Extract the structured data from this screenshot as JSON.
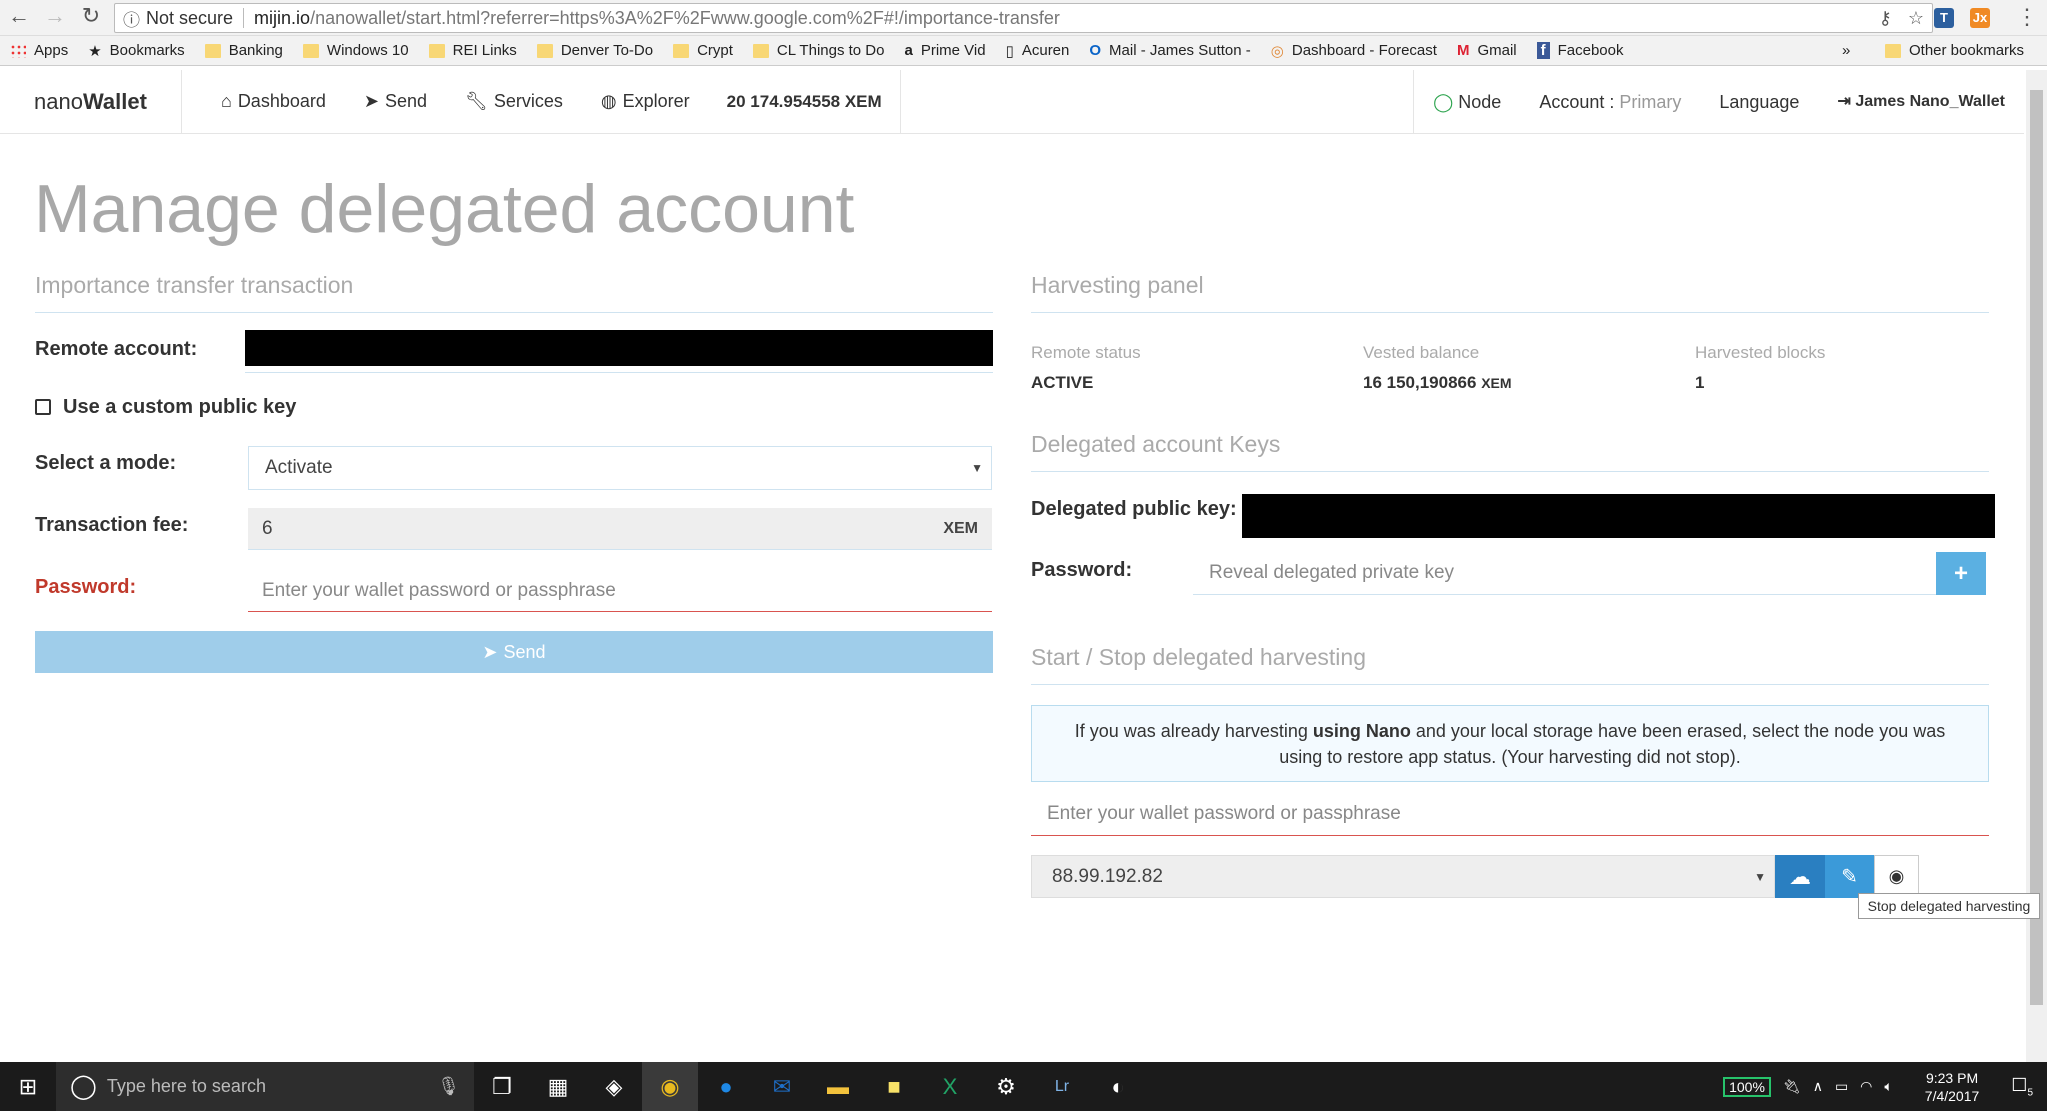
{
  "browser": {
    "security": "Not secure",
    "url_host": "mijin.io",
    "url_path": "/nanowallet/start.html?referrer=https%3A%2F%2Fwww.google.com%2F#!/importance-transfer",
    "bookmarks": [
      "Apps",
      "Bookmarks",
      "Banking",
      "Windows 10",
      "REI Links",
      "Denver To-Do",
      "Crypt",
      "CL Things to Do",
      "Prime Vid",
      "Acuren",
      "Mail - James Sutton -",
      "Dashboard - Forecast",
      "Gmail",
      "Facebook"
    ],
    "more": "»",
    "other_bookmarks": "Other bookmarks"
  },
  "nav": {
    "brand_light": "nano",
    "brand_bold": "Wallet",
    "dashboard": "Dashboard",
    "send": "Send",
    "services": "Services",
    "explorer": "Explorer",
    "balance": "20 174.954558 XEM",
    "node": "Node",
    "account_label": "Account : ",
    "account_value": "Primary",
    "language": "Language",
    "user": "James Nano_Wallet"
  },
  "page": {
    "title": "Manage delegated account"
  },
  "left": {
    "section": "Importance transfer transaction",
    "remote_account": "Remote account:",
    "custom_key": "Use a custom public key",
    "mode_label": "Select a mode:",
    "mode_value": "Activate",
    "fee_label": "Transaction fee:",
    "fee_value": "6",
    "fee_unit": "XEM",
    "password_label": "Password:",
    "password_placeholder": "Enter your wallet password or passphrase",
    "send_button": "Send"
  },
  "right": {
    "harvest_title": "Harvesting panel",
    "remote_status_label": "Remote status",
    "remote_status_value": "ACTIVE",
    "vested_label": "Vested balance",
    "vested_value": "16 150,190866",
    "vested_unit": "XEM",
    "blocks_label": "Harvested blocks",
    "blocks_value": "1",
    "keys_title": "Delegated account Keys",
    "pubkey_label": "Delegated public key:",
    "password_label": "Password:",
    "reveal_placeholder": "Reveal delegated private key",
    "startstop_title": "Start / Stop delegated harvesting",
    "info_pre": "If you was already harvesting ",
    "info_bold": "using Nano",
    "info_post": " and your local storage have been erased, select the node you was using to restore app status. (Your harvesting did not stop).",
    "wallet_placeholder": "Enter your wallet password or passphrase",
    "node_value": "88.99.192.82",
    "tooltip": "Stop delegated harvesting"
  },
  "taskbar": {
    "search_placeholder": "Type here to search",
    "battery": "100%",
    "time": "9:23 PM",
    "date": "7/4/2017",
    "notif_count": "5"
  }
}
